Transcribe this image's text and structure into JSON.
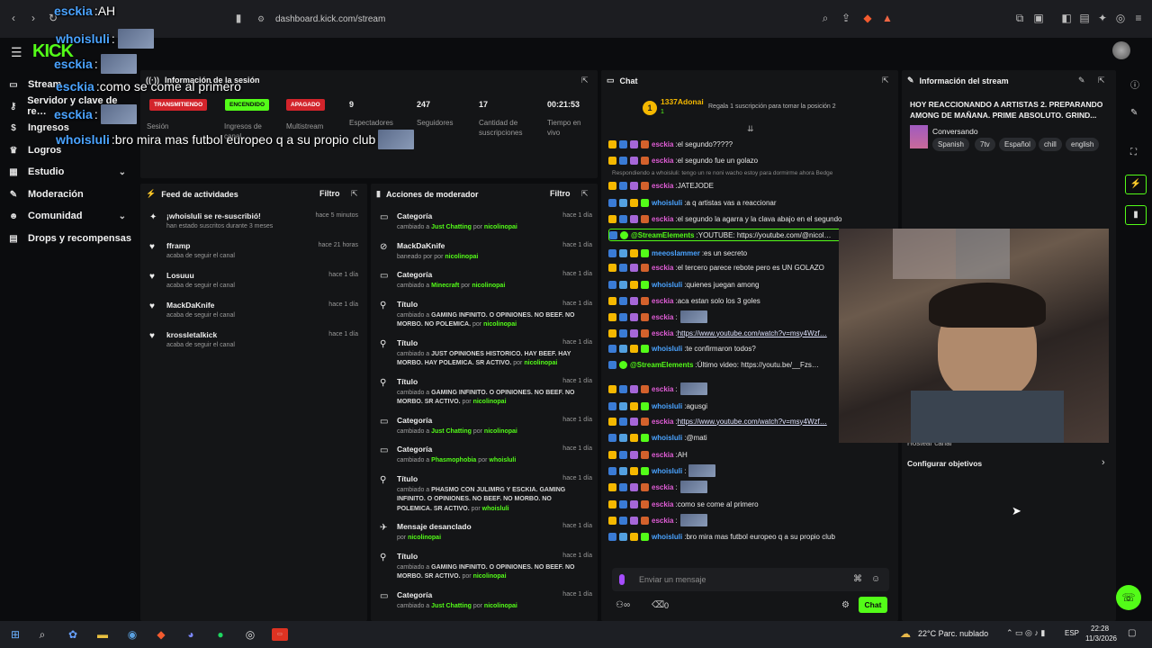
{
  "browser": {
    "url": "dashboard.kick.com/stream"
  },
  "sidebar": {
    "items": [
      {
        "label": "Stream",
        "icon": "stream-icon"
      },
      {
        "label": "Servidor y clave de re…",
        "icon": "key-icon"
      },
      {
        "label": "Ingresos",
        "icon": "dollar-icon"
      },
      {
        "label": "Logros",
        "icon": "trophy-icon"
      },
      {
        "label": "Estudio",
        "icon": "grid-icon"
      },
      {
        "label": "Moderación",
        "icon": "wrench-icon"
      },
      {
        "label": "Comunidad",
        "icon": "users-icon"
      },
      {
        "label": "Drops y recompensas",
        "icon": "gift-icon"
      }
    ]
  },
  "session": {
    "title": "Información de la sesión",
    "badges": {
      "live": "TRANSMITIENDO",
      "on": "ENCENDIDO",
      "off": "APAGADO"
    },
    "labels": {
      "session": "Sesión",
      "income": "Ingresos de",
      "income2": "canal",
      "multistream": "Multistream"
    },
    "stats": [
      {
        "value": "9",
        "label": "Espectadores"
      },
      {
        "value": "247",
        "label": "Seguidores"
      },
      {
        "value": "17",
        "label": "Cantidad de suscripciones"
      },
      {
        "value": "00:21:53",
        "label": "Tiempo en vivo"
      }
    ]
  },
  "activity": {
    "title": "Feed de actividades",
    "filter": "Filtro",
    "items": [
      {
        "title": "¡whoisluli se re-suscribió!",
        "sub": "han estado suscritos durante 3 meses",
        "time": "hace 5 minutos",
        "icon": "star-icon"
      },
      {
        "title": "fframp",
        "sub": "acaba de seguir el canal",
        "time": "hace 21 horas",
        "icon": "heart-icon"
      },
      {
        "title": "Losuuu",
        "sub": "acaba de seguir el canal",
        "time": "hace 1 día",
        "icon": "heart-icon"
      },
      {
        "title": "MackDaKnife",
        "sub": "acaba de seguir el canal",
        "time": "hace 1 día",
        "icon": "heart-icon"
      },
      {
        "title": "krossletalkick",
        "sub": "acaba de seguir el canal",
        "time": "hace 1 día",
        "icon": "heart-icon"
      }
    ]
  },
  "modactions": {
    "title": "Acciones de moderador",
    "filter": "Filtro",
    "items": [
      {
        "title": "Categoría",
        "pre": "cambiado a",
        "val": "Just Chatting",
        "by": "nicolinopai",
        "time": "hace 1 día",
        "icon": "category-icon"
      },
      {
        "title": "MackDaKnife",
        "pre": "baneado por",
        "val": "",
        "by": "nicolinopai",
        "time": "hace 1 día",
        "icon": "ban-icon"
      },
      {
        "title": "Categoría",
        "pre": "cambiado a",
        "val": "Minecraft",
        "by": "nicolinopai",
        "time": "hace 1 día",
        "icon": "category-icon"
      },
      {
        "title": "Título",
        "pre": "cambiado a",
        "val": "GAMING INFINITO. O OPINIONES. NO BEEF. NO MORBO. NO POLEMICA.",
        "by": "nicolinopai",
        "time": "hace 1 día",
        "icon": "title-icon"
      },
      {
        "title": "Título",
        "pre": "cambiado a",
        "val": "JUST OPINIONES HISTORICO. HAY BEEF. HAY MORBO. HAY POLEMICA. SR ACTIVO.",
        "by": "nicolinopai",
        "time": "hace 1 día",
        "icon": "title-icon"
      },
      {
        "title": "Título",
        "pre": "cambiado a",
        "val": "GAMING INFINITO. O OPINIONES. NO BEEF. NO MORBO. SR ACTIVO.",
        "by": "nicolinopai",
        "time": "hace 1 día",
        "icon": "title-icon"
      },
      {
        "title": "Categoría",
        "pre": "cambiado a",
        "val": "Just Chatting",
        "by": "nicolinopai",
        "time": "hace 1 día",
        "icon": "category-icon"
      },
      {
        "title": "Categoría",
        "pre": "cambiado a",
        "val": "Phasmophobia",
        "by": "whoisluli",
        "time": "hace 1 día",
        "icon": "category-icon"
      },
      {
        "title": "Título",
        "pre": "cambiado a",
        "val": "PHASMO CON JULIMRG Y ESCKIA. GAMING INFINITO. O OPINIONES. NO BEEF. NO MORBO. NO POLEMICA. SR ACTIVO.",
        "by": "whoisluli",
        "time": "hace 1 día",
        "icon": "title-icon"
      },
      {
        "title": "Mensaje desanclado",
        "pre": "",
        "val": "",
        "by": "nicolinopai",
        "time": "hace 1 día",
        "icon": "unpin-icon"
      },
      {
        "title": "Título",
        "pre": "cambiado a",
        "val": "GAMING INFINITO. O OPINIONES. NO BEEF. NO MORBO. SR ACTIVO.",
        "by": "nicolinopai",
        "time": "hace 1 día",
        "icon": "title-icon"
      },
      {
        "title": "Categoría",
        "pre": "cambiado a",
        "val": "Just Chatting",
        "by": "nicolinopai",
        "time": "hace 1 día",
        "icon": "category-icon"
      }
    ],
    "by_word": "por"
  },
  "chat": {
    "title": "Chat",
    "top_user": "1337Adonai",
    "top_count": "1",
    "gift_text": "Regala 1 suscripción para tomar la posición 2",
    "reply_text": "Respondiendo a whoisluli: tengo un re noni wacho estoy para dormirme ahora Bedge",
    "input_placeholder": "Enviar un mensaje",
    "send_label": "Chat",
    "viewer_count": "0",
    "messages": [
      {
        "user": "esckia",
        "color": "#e05dd6",
        "text": "el segundo?????"
      },
      {
        "user": "esckia",
        "color": "#e05dd6",
        "text": "el segundo fue un golazo"
      },
      {
        "user": "esckia",
        "color": "#e05dd6",
        "text": "JATEJODE"
      },
      {
        "user": "whoisluli",
        "color": "#4aa3ff",
        "text": "a q artistas vas a reaccionar"
      },
      {
        "user": "esckia",
        "color": "#e05dd6",
        "text": "el segundo la agarra y la clava abajo en el segundo"
      },
      {
        "user": "@StreamElements",
        "color": "#53fc18",
        "text": "YOUTUBE: https://youtube.com/@nicol…"
      },
      {
        "user": "meeoslammer",
        "color": "#4aa3ff",
        "text": "es un secreto"
      },
      {
        "user": "esckia",
        "color": "#e05dd6",
        "text": "el tercero parece rebote pero es UN GOLAZO"
      },
      {
        "user": "whoisluli",
        "color": "#4aa3ff",
        "text": "quienes juegan among"
      },
      {
        "user": "esckia",
        "color": "#e05dd6",
        "text": "aca estan solo los 3 goles"
      },
      {
        "user": "esckia",
        "color": "#e05dd6",
        "text": ""
      },
      {
        "user": "esckia",
        "color": "#e05dd6",
        "text": "https://www.youtube.com/watch?v=msy4Wzf…"
      },
      {
        "user": "whoisluli",
        "color": "#4aa3ff",
        "text": "te confirmaron todos?"
      },
      {
        "user": "@StreamElements",
        "color": "#53fc18",
        "text": "Último video: https://youtu.be/__Fzs…"
      },
      {
        "user": "esckia",
        "color": "#e05dd6",
        "text": ""
      },
      {
        "user": "whoisluli",
        "color": "#4aa3ff",
        "text": "agusgi"
      },
      {
        "user": "esckia",
        "color": "#e05dd6",
        "text": "https://www.youtube.com/watch?v=msy4Wzf…"
      },
      {
        "user": "whoisluli",
        "color": "#4aa3ff",
        "text": "@mati"
      },
      {
        "user": "esckia",
        "color": "#e05dd6",
        "text": "AH"
      },
      {
        "user": "whoisluli",
        "color": "#4aa3ff",
        "text": ""
      },
      {
        "user": "esckia",
        "color": "#e05dd6",
        "text": ""
      },
      {
        "user": "esckia",
        "color": "#e05dd6",
        "text": "como se come al primero"
      },
      {
        "user": "esckia",
        "color": "#e05dd6",
        "text": ""
      },
      {
        "user": "whoisluli",
        "color": "#4aa3ff",
        "text": "bro mira mas futbol europeo q a su propio club"
      }
    ]
  },
  "streaminfo": {
    "title": "Información del stream",
    "stream_title": "HOY REACCIONANDO A ARTISTAS 2. PREPARANDO AMONG DE MAÑANA. PRIME ABSOLUTO. GRIND...",
    "category": "Conversando",
    "tags": [
      "Spanish",
      "7tv",
      "Español",
      "chill",
      "english"
    ],
    "host_partial": "Hostear canal",
    "goals": "Configurar objetivos"
  },
  "overlay": {
    "lines": [
      {
        "user": "esckia",
        "text": "AH"
      },
      {
        "user": "whoisluli",
        "text": ""
      },
      {
        "user": "esckia",
        "text": ""
      },
      {
        "user": "esckia",
        "text": "como se come al primero"
      },
      {
        "user": "esckia",
        "text": ""
      },
      {
        "user": "whoisluli",
        "text": "bro mira mas futbol europeo q a su propio club"
      }
    ]
  },
  "taskbar": {
    "weather": "22°C  Parc. nublado",
    "lang": "ESP",
    "time": "22:28",
    "date": "11/3/2026"
  }
}
